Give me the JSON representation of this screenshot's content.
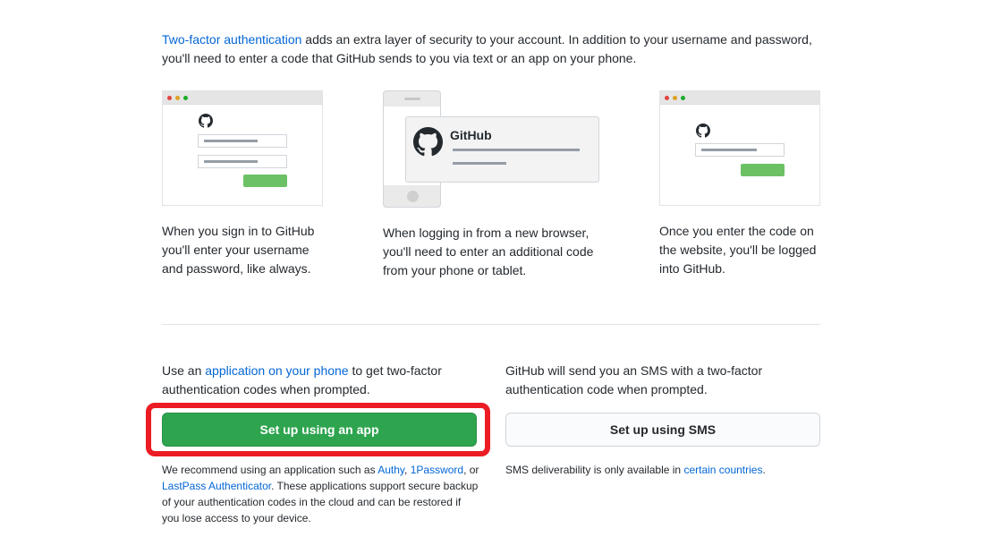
{
  "intro": {
    "link": "Two-factor authentication",
    "text": " adds an extra layer of security to your account. In addition to your username and password, you'll need to enter a code that GitHub sends to you via text or an app on your phone."
  },
  "steps": [
    {
      "caption": "When you sign in to GitHub you'll enter your username and password, like always."
    },
    {
      "caption": "When logging in from a new browser, you'll need to enter an additional code from your phone or tablet.",
      "notification_title": "GitHub"
    },
    {
      "caption": "Once you enter the code on the website, you'll be logged into GitHub."
    }
  ],
  "app_option": {
    "desc_prefix": "Use an ",
    "desc_link": "application on your phone",
    "desc_suffix": " to get two-factor authentication codes when prompted.",
    "button_label": "Set up using an app",
    "note_prefix": "We recommend using an application such as ",
    "note_link_authy": "Authy",
    "note_sep1": ", ",
    "note_link_1password": "1Password",
    "note_sep2": ", or ",
    "note_link_lastpass": "LastPass Authenticator",
    "note_suffix": ". These applications support secure backup of your authentication codes in the cloud and can be restored if you lose access to your device."
  },
  "sms_option": {
    "desc": "GitHub will send you an SMS with a two-factor authentication code when prompted.",
    "button_label": "Set up using SMS",
    "note_prefix": "SMS deliverability is only available in ",
    "note_link": "certain countries",
    "note_suffix": "."
  },
  "colors": {
    "link": "#0366d6",
    "primary_button": "#2ea44f",
    "highlight": "#ec1c24"
  },
  "icons": [
    "github-octocat-icon"
  ]
}
